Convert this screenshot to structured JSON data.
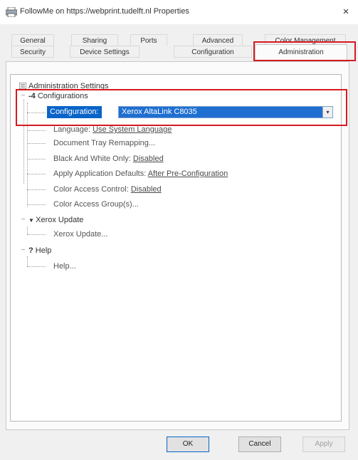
{
  "window": {
    "title": "FollowMe on https://webprint.tudelft.nl Properties",
    "close_glyph": "×",
    "app_icon": "printer-icon"
  },
  "tabs": {
    "row_back": [
      "General",
      "Sharing",
      "Ports",
      "Advanced",
      "Color Management"
    ],
    "row_front": [
      "Security",
      "Device Settings",
      "Configuration",
      "Administration"
    ],
    "active": "Administration"
  },
  "tree": {
    "root": {
      "label": "Administration Settings",
      "icon": "settings-list-icon"
    },
    "configurations": {
      "label": "Configurations",
      "icon": "config-icon",
      "toggle": "−",
      "configuration": {
        "label": "Configuration:",
        "value": "Xerox AltaLink C8035",
        "arrow": "▾"
      },
      "language": {
        "label": "Language:",
        "value": "Use System Language"
      },
      "document_tray": {
        "label": "Document Tray Remapping..."
      },
      "bw_only": {
        "label": "Black And White Only:",
        "value": "Disabled"
      },
      "apply_defaults": {
        "label": "Apply Application Defaults:",
        "value": "After Pre-Configuration"
      },
      "color_access_control": {
        "label": "Color Access Control:",
        "value": "Disabled"
      },
      "color_access_groups": {
        "label": "Color Access Group(s)..."
      }
    },
    "xerox_update": {
      "label": "Xerox Update",
      "icon": "update-icon",
      "toggle": "−",
      "child": "Xerox Update..."
    },
    "help": {
      "label": "Help",
      "icon": "help-icon",
      "glyph": "?",
      "toggle": "−",
      "child": "Help..."
    }
  },
  "buttons": {
    "ok": "OK",
    "cancel": "Cancel",
    "apply": "Apply"
  },
  "colors": {
    "highlight_red": "#d71920",
    "selection_blue": "#0a64c8"
  }
}
